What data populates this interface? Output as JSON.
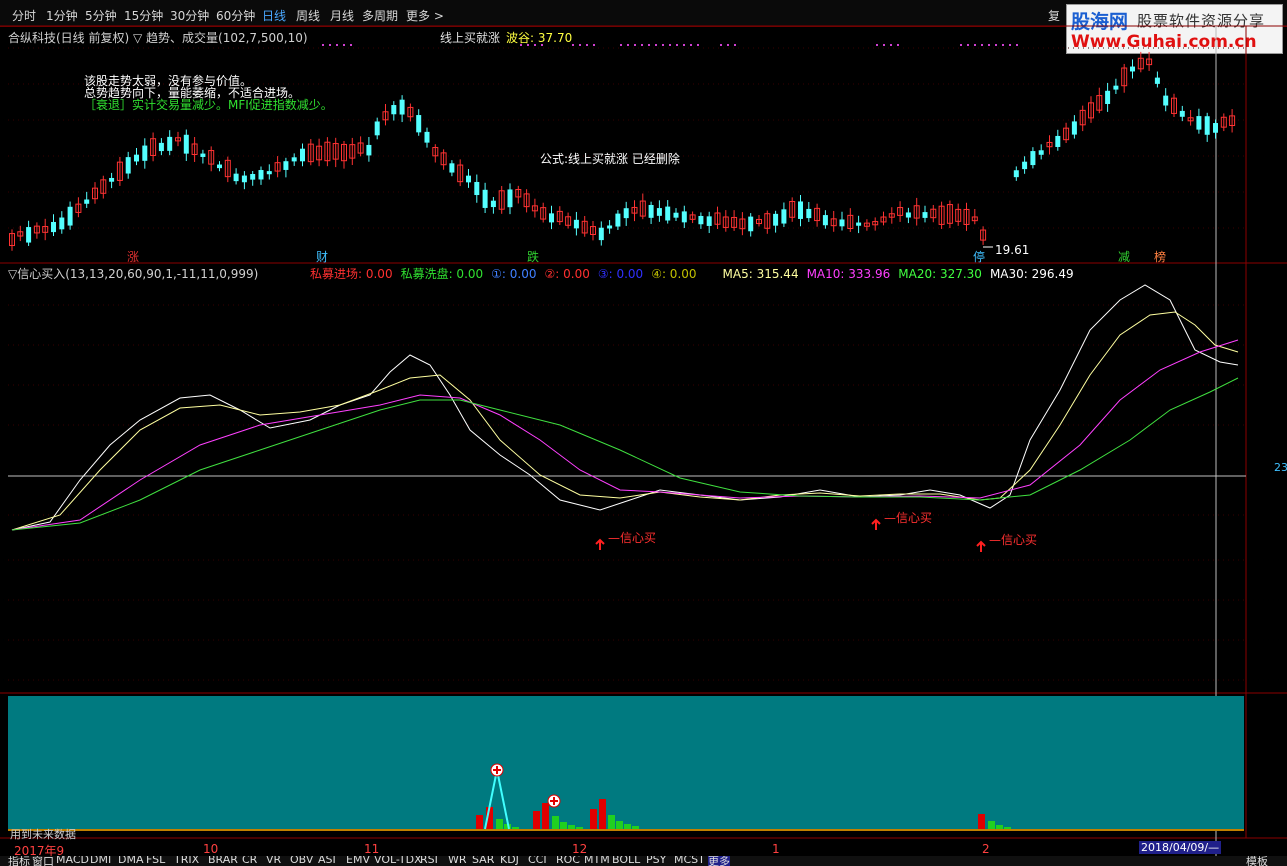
{
  "toolbar": {
    "periods": [
      "分时",
      "1分钟",
      "5分钟",
      "15分钟",
      "30分钟",
      "60分钟",
      "日线",
      "周线",
      "月线",
      "多周期",
      "更多 >"
    ],
    "active": "日线",
    "right_label": "复"
  },
  "logo": {
    "line1a": "股海网",
    "line1b": "股票软件资源分享",
    "line2": "Www.Guhai.com.cn"
  },
  "main_panel": {
    "header": "合纵科技(日线 前复权) ▽ 趋势、成交量(102,7,500,10)",
    "formula_label": "线上买就涨",
    "wave_label": "波谷: 37.70",
    "messages": [
      "该股走势太弱，没有参与价值。",
      "总势趋势向下，量能萎缩，不适合进场。",
      "［衰退］实计交易量减少。MFI促进指数减少。"
    ],
    "deleted_notice": "公式:线上买就涨 已经删除",
    "low_price": "19.61",
    "markers": [
      {
        "text": "涨",
        "color": "#e03030"
      },
      {
        "text": "财",
        "color": "#40c0ff"
      },
      {
        "text": "跌",
        "color": "#30d030"
      },
      {
        "text": "停",
        "color": "#40c0ff"
      },
      {
        "text": "减",
        "color": "#30d030"
      },
      {
        "text": "榜",
        "color": "#ff8040"
      }
    ]
  },
  "indicator_panel": {
    "name": "▽信心买入(13,13,20,60,90,1,-11,11,0,999)",
    "stats": [
      {
        "label": "私募进场: ",
        "value": "0.00",
        "color": "#ff3030"
      },
      {
        "label": "私募洗盘: ",
        "value": "0.00",
        "color": "#30e030"
      },
      {
        "label": "①: ",
        "value": "0.00",
        "color": "#4080ff"
      },
      {
        "label": "②: ",
        "value": "0.00",
        "color": "#ff3030"
      },
      {
        "label": "③: ",
        "value": "0.00",
        "color": "#3030ff"
      },
      {
        "label": "④: ",
        "value": "0.00",
        "color": "#c0c000"
      },
      {
        "label": "MA5: ",
        "value": "315.44",
        "color": "#ffffa0"
      },
      {
        "label": "MA10: ",
        "value": "333.96",
        "color": "#ff40ff"
      },
      {
        "label": "MA20: ",
        "value": "327.30",
        "color": "#40ff40"
      },
      {
        "label": "MA30: ",
        "value": "296.49",
        "color": "#ffffff"
      }
    ],
    "buy_signal": "信心买",
    "right_axis": "23"
  },
  "volume_panel": {
    "note": "用到未来数据"
  },
  "date_axis": {
    "labels": [
      "2017年9",
      "10",
      "11",
      "12",
      "1",
      "2"
    ],
    "cursor_date": "2018/04/09/—"
  },
  "bottom_tabs": [
    "指标",
    "窗口",
    "MACD",
    "DMI",
    "DMA",
    "FSL",
    "TRIX",
    "BRAR",
    "CR",
    "VR",
    "OBV",
    "ASI",
    "EMV",
    "VOL-TDX",
    "RSI",
    "WR",
    "SAR",
    "KDJ",
    "CCI",
    "ROC",
    "MTM",
    "BOLL",
    "PSY",
    "MCST",
    "更多"
  ],
  "bottom_right": "模板",
  "colors": {
    "up": "#ff3232",
    "down": "#54ffff",
    "panel_border": "#8b0000",
    "teal": "#007a80"
  }
}
